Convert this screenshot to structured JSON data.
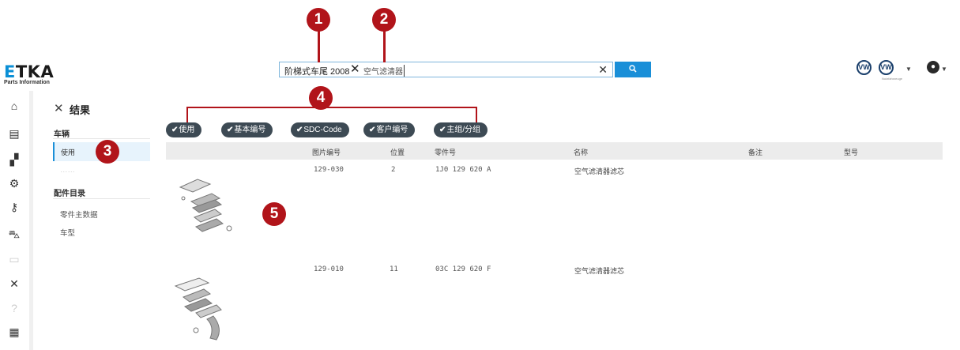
{
  "logo": {
    "main_e": "E",
    "main_rest": "TKA",
    "sub": "Parts Information"
  },
  "search": {
    "chip_label": "阶梯式车尾 2008",
    "chip_close": "✕",
    "query": "空气滤清器",
    "clear": "✕",
    "button_icon": "🔍"
  },
  "header": {
    "brand_logos": [
      "VW",
      "VW"
    ],
    "brand_caption": "Nutzfahrzeuge",
    "user_icon": "user-icon"
  },
  "rail": {
    "icons": [
      "home-icon",
      "catalog-icon",
      "parts-icon",
      "settings-gear-icon",
      "key-icon",
      "car-icon",
      "document-icon",
      "tools-icon",
      "help-icon",
      "qr-icon"
    ]
  },
  "panel": {
    "close": "✕",
    "title": "结果",
    "sections": [
      {
        "label": "车辆",
        "items": [
          "使用",
          "……"
        ]
      },
      {
        "label": "配件目录",
        "items": [
          "零件主数据",
          "车型"
        ]
      }
    ]
  },
  "filters": [
    "使用",
    "基本编号",
    "SDC-Code",
    "客户编号",
    "主组/分组"
  ],
  "table": {
    "headers": [
      "图片编号",
      "位置",
      "零件号",
      "名称",
      "备注",
      "型号"
    ],
    "rows": [
      {
        "image_no": "129-030",
        "pos": "2",
        "part_no": "1J0 129 620 A",
        "name": "空气滤清器滤芯",
        "note": "",
        "model": ""
      },
      {
        "image_no": "129-010",
        "pos": "11",
        "part_no": "03C 129 620 F",
        "name": "空气滤清器滤芯",
        "note": "",
        "model": ""
      }
    ]
  },
  "callouts": [
    "1",
    "2",
    "3",
    "4",
    "5"
  ],
  "colors": {
    "accent": "#1a8fd8",
    "pill": "#3d4a54",
    "callout": "#b1141a"
  }
}
